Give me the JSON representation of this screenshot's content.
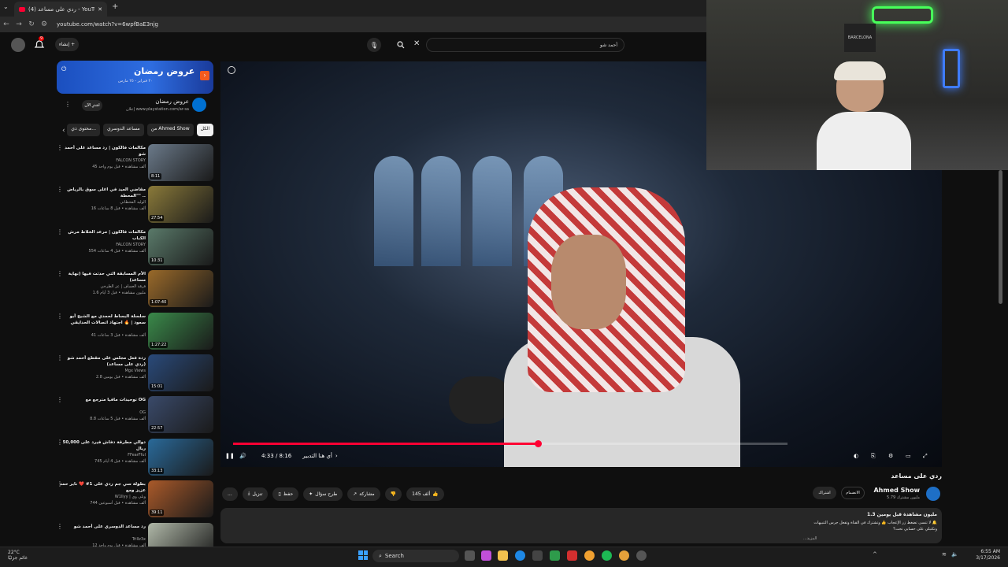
{
  "browser": {
    "tab_title": "(4) ردي على مساعد - YouTube",
    "url": "youtube.com/watch?v=6wpfBaE3njg"
  },
  "header": {
    "create_label": "إنشاء",
    "search_value": "أحمد شو",
    "notif_count": "9"
  },
  "ad": {
    "banner_text": "عروض رمضان",
    "banner_sub": "٢٠ فبراير - ٢٥ مارس",
    "title": "عروض رمضان",
    "url": "www.playstation.com/ar-sa",
    "sponsor": "إعلان",
    "cta": "اشترِ الآن"
  },
  "chips": [
    {
      "label": "الكل"
    },
    {
      "label": "من Ahmed Show"
    },
    {
      "label": "مساعد الدوسري"
    },
    {
      "label": "محتوى ذي..."
    }
  ],
  "sidebar": [
    {
      "title": "مكالمات فالكون | رد مساعد على أحمد شو",
      "channel": "FALCON STORY",
      "meta": "45 ألف مشاهدة • قبل يوم واحد",
      "duration": "8:11",
      "color": "#6b7a8a"
    },
    {
      "title": "مقاضي العيد في اغلى سوق بالرياض \"المحطة\" ..",
      "channel": "الوليد الفحطاني",
      "meta": "16 ألف مشاهدة • قبل 8 ساعات",
      "duration": "27:54",
      "color": "#8a7a3a"
    },
    {
      "title": "مكالمات فالكون | مرعد الخلاط مرش الكباب",
      "channel": "FALCON STORY",
      "meta": "554 ألف مشاهدة • قبل 4 ساعات",
      "duration": "10:31",
      "color": "#5a7a6a"
    },
    {
      "title": "الأم المسابقة التي حدثت فيها (نهاية مساعد)",
      "channel": "فرقة العساف | عز الطرخي",
      "meta": "1.6 مليون مشاهدة • قبل 3 أيام",
      "duration": "1:07:40",
      "color": "#9a6a2a"
    },
    {
      "title": "سلسلة البساط لحمدي مع الشيخ أبو سعود | 🔥 اجتهاد اتصالات الحدايقي",
      "channel": "",
      "meta": "41 ألف مشاهدة • قبل 3 ساعات",
      "duration": "1:27:22",
      "color": "#3a8a4a"
    },
    {
      "title": "ردة فعل مجلس على مقطع أحمد شو (ردي على مساعد)",
      "channel": "Mgx Views",
      "meta": "2.8 ألف مشاهدة • قبل يومين",
      "duration": "15:01",
      "color": "#2a4a7a"
    },
    {
      "title": "توحيدات مافيا مترجع مع OG",
      "channel": "OG",
      "meta": "8.8 ألف مشاهدة • قبل 5 ساعات",
      "duration": "22:57",
      "color": "#3a4a6a"
    },
    {
      "title": "دوالي مطرقة دفاش فيرد على 50,000 ريال",
      "channel": "FFearFful",
      "meta": "745 ألف مشاهدة • قبل 4 أيام",
      "duration": "33:13",
      "color": "#2a6a9a"
    },
    {
      "title": "بطولة سي جم ردي على 1# ❤️ ناير حمد عزيز ومع",
      "channel": "W1llyy | ويلي وي",
      "meta": "744 ألف مشاهدة • قبل أسبوعين",
      "duration": "39:11",
      "color": "#aa5a2a"
    },
    {
      "title": "رد مساعد الدوسري على أحمد شو",
      "channel": "Trillz3x",
      "meta": "12 ألف مشاهدة • قبل يوم واحد",
      "duration": "",
      "color": "#b0b8a8"
    }
  ],
  "player": {
    "time": "4:33 / 8:16",
    "chapter": "أي هنا التدبير",
    "progress": 0.55
  },
  "video": {
    "title": "ردي على مساعد",
    "channel": "Ahmed Show",
    "subs": "5.79 مليون مشترك",
    "join_label": "الانضمام",
    "subscribe_label": "اشتراك",
    "likes": "145 ألف",
    "share_label": "مشاركة",
    "ask_label": "طرح سؤال",
    "save_label": "حفظ",
    "download_label": "تنزيل",
    "more_label": "...",
    "stats": "1.3 مليون مشاهدة  قبل يومين",
    "desc_line1": "لا تنسى تضغط زر الإعجاب 👍 وتشترك في القناة وتفعل جرس التنبيهات 🔔",
    "desc_line2": "وتكتبلي على حسابي تحت؟",
    "more": "...المزيد"
  },
  "taskbar": {
    "temp": "22°C",
    "weather": "غائم جزئيًا",
    "search": "Search",
    "time": "6:55 AM",
    "date": "3/17/2026"
  },
  "webcam": {
    "flag_text": "BARCELONA"
  }
}
